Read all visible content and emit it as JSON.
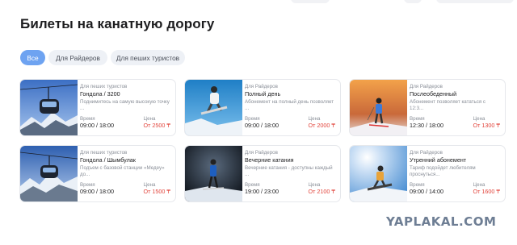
{
  "page": {
    "title": "Билеты на канатную дорогу"
  },
  "filters": [
    {
      "label": "Все",
      "active": true
    },
    {
      "label": "Для Райдеров",
      "active": false
    },
    {
      "label": "Для пеших туристов",
      "active": false
    }
  ],
  "common": {
    "time_label": "Время",
    "price_label": "Цена"
  },
  "tickets": [
    {
      "category": "Для пеших туристов",
      "name": "Гондола / 3200",
      "description": "Поднимитесь на самую высокую точку ...",
      "time": "09:00 / 18:00",
      "price": "От 2500 ₸",
      "image": "gondola-photo"
    },
    {
      "category": "Для Райдеров",
      "name": "Полный день",
      "description": "Абонемент на полный день позволяет ...",
      "time": "09:00 / 18:00",
      "price": "От 2000 ₸",
      "image": "snowboarder-jump-photo"
    },
    {
      "category": "Для Райдеров",
      "name": "Послеобеденный",
      "description": "Абонемент позволяет кататься с 12:3...",
      "time": "12:30 / 18:00",
      "price": "От 1300 ₸",
      "image": "skier-sunset-photo"
    },
    {
      "category": "Для пеших туристов",
      "name": "Гондола / Шымбулак",
      "description": "Подъем с базовой станции «Медеу» до...",
      "time": "09:00 / 18:00",
      "price": "От 1500 ₸",
      "image": "gondola-mountains-photo"
    },
    {
      "category": "Для Райдеров",
      "name": "Вечерние катания",
      "description": "Вечерние катания - доступны каждый ...",
      "time": "19:00 / 23:00",
      "price": "От 2100 ₸",
      "image": "night-skier-photo"
    },
    {
      "category": "Для Райдеров",
      "name": "Утренний абонемент",
      "description": "Тариф подойдет любителям проснуться...",
      "time": "09:00 / 14:00",
      "price": "От 1600 ₸",
      "image": "snowboarder-sun-photo"
    }
  ],
  "watermark": "YAPLAKAL.COM"
}
